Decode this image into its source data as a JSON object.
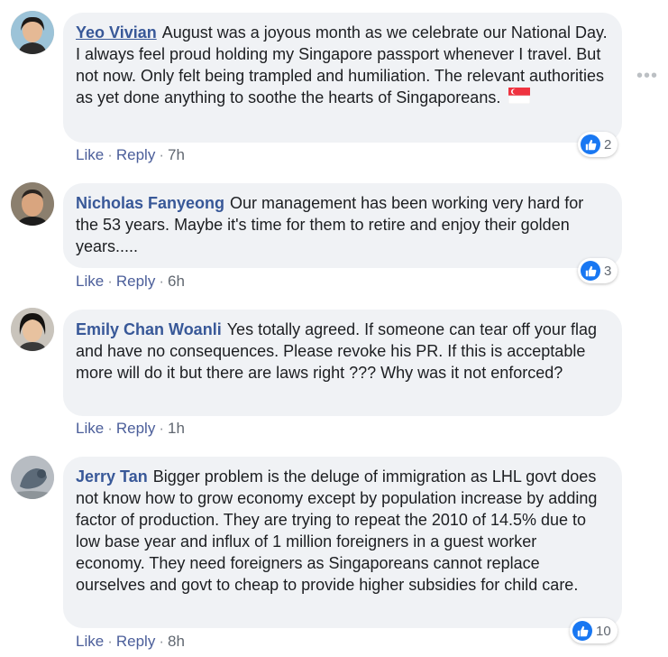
{
  "comments": [
    {
      "name": "Yeo Vivian",
      "text": "August was a joyous month as we celebrate our National Day. I always feel proud holding my Singapore passport whenever I travel. But not now. Only felt being trampled and humiliation. The relevant authorities as yet done anything to soothe the hearts of Singaporeans.",
      "like": "Like",
      "reply": "Reply",
      "time": "7h",
      "reaction_count": "2"
    },
    {
      "name": "Nicholas Fanyeong",
      "text": "Our management has been working very hard for the 53 years. Maybe it's time for them to retire and enjoy their golden years.....",
      "like": "Like",
      "reply": "Reply",
      "time": "6h",
      "reaction_count": "3"
    },
    {
      "name": "Emily Chan Woanli",
      "text": "Yes totally agreed. If someone can tear off your flag and have no consequences. Please revoke his PR. If this is acceptable more will do it but there are laws right ??? Why was it not enforced?",
      "like": "Like",
      "reply": "Reply",
      "time": "1h"
    },
    {
      "name": "Jerry Tan",
      "text": "Bigger problem is the deluge of immigration as LHL govt does not know how to grow economy except by population increase by adding factor of production. They are trying to repeat the 2010 of 14.5% due to low base year and influx of 1 million foreigners in a guest worker economy. They need foreigners as Singaporeans cannot replace ourselves and govt to cheap to provide higher subsidies for child care.",
      "like": "Like",
      "reply": "Reply",
      "time": "8h",
      "reaction_count": "10"
    }
  ],
  "icons": {
    "more": "more-options-icon",
    "like": "like-reaction-icon",
    "flag": "singapore-flag-emoji"
  },
  "colors": {
    "name": "#385898",
    "bubble": "#f0f2f5",
    "like_blue": "#1877f2"
  }
}
